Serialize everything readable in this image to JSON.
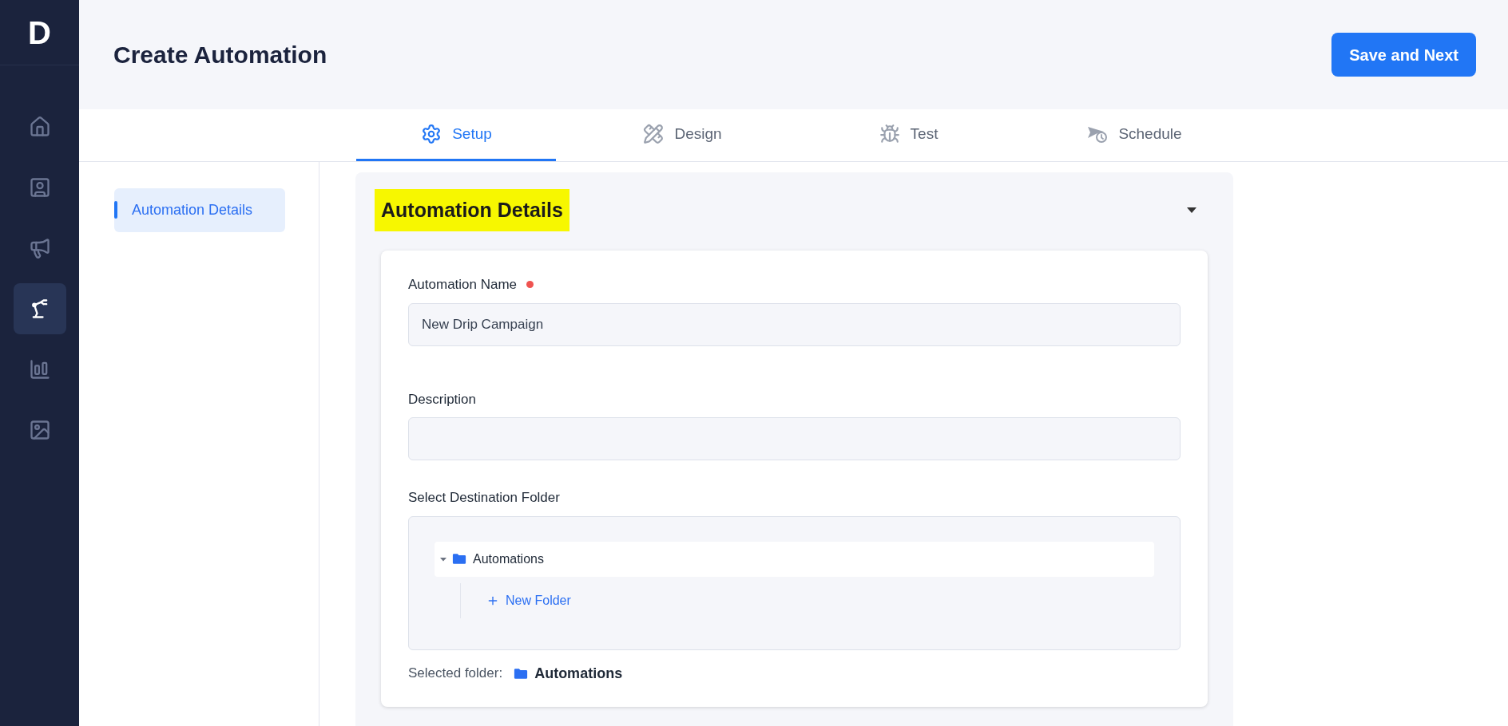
{
  "logo": "D",
  "sidebar": {
    "items": [
      {
        "selected": false
      },
      {
        "selected": false
      },
      {
        "selected": false
      },
      {
        "selected": true
      },
      {
        "selected": false
      },
      {
        "selected": false
      }
    ]
  },
  "header": {
    "title": "Create Automation",
    "primary_button": "Save and Next"
  },
  "tabs": [
    {
      "label": "Setup",
      "selected": true
    },
    {
      "label": "Design",
      "selected": false
    },
    {
      "label": "Test",
      "selected": false
    },
    {
      "label": "Schedule",
      "selected": false
    }
  ],
  "section_nav": [
    {
      "label": "Automation Details",
      "selected": true
    }
  ],
  "section": {
    "title": "Automation Details",
    "highlighted": true,
    "expanded": true,
    "fields": [
      {
        "label": "Automation Name",
        "required": true,
        "value": "New Drip Campaign"
      },
      {
        "label": "Description",
        "required": false
      }
    ],
    "folder_picker": {
      "label": "Select Destination Folder",
      "tree": [
        {
          "label": "Automations",
          "expanded": true,
          "selected": true
        }
      ],
      "new_folder": "New Folder",
      "selected_label": "Selected folder:",
      "selected_value": "Automations"
    }
  }
}
